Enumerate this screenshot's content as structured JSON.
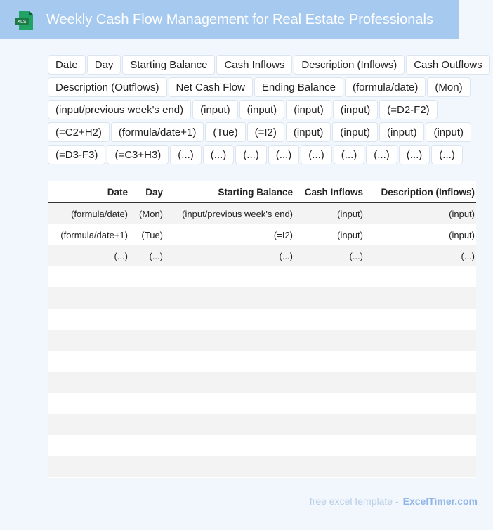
{
  "header": {
    "title": "Weekly Cash Flow Management for Real Estate Professionals",
    "icon_label": "XLS",
    "icon_color": "#1d7a45",
    "background": "#a6c9f0"
  },
  "chips": [
    "Date",
    "Day",
    "Starting Balance",
    "Cash Inflows",
    "Description (Inflows)",
    "Cash Outflows",
    "Description (Outflows)",
    "Net Cash Flow",
    "Ending Balance",
    "(formula/date)",
    "(Mon)",
    "(input/previous week's end)",
    "(input)",
    "(input)",
    "(input)",
    "(input)",
    "(=D2-F2)",
    "(=C2+H2)",
    "(formula/date+1)",
    "(Tue)",
    "(=I2)",
    "(input)",
    "(input)",
    "(input)",
    "(input)",
    "(=D3-F3)",
    "(=C3+H3)",
    "(...)",
    "(...)",
    "(...)",
    "(...)",
    "(...)",
    "(...)",
    "(...)",
    "(...)",
    "(...)"
  ],
  "table": {
    "columns": [
      "Date",
      "Day",
      "Starting Balance",
      "Cash Inflows",
      "Description (Inflows)"
    ],
    "rows": [
      {
        "num": "0",
        "cells": [
          "(formula/date)",
          "(Mon)",
          "(input/previous week's end)",
          "(input)",
          "(input)"
        ]
      },
      {
        "num": "1",
        "cells": [
          "(formula/date+1)",
          "(Tue)",
          "(=I2)",
          "(input)",
          "(input)"
        ]
      },
      {
        "num": "2",
        "cells": [
          "(...)",
          "(...)",
          "(...)",
          "(...)",
          "(...)"
        ]
      },
      {
        "num": "3",
        "cells": [
          "",
          "",
          "",
          "",
          ""
        ]
      },
      {
        "num": "4",
        "cells": [
          "",
          "",
          "",
          "",
          ""
        ]
      },
      {
        "num": "5",
        "cells": [
          "",
          "",
          "",
          "",
          ""
        ]
      },
      {
        "num": "6",
        "cells": [
          "",
          "",
          "",
          "",
          ""
        ]
      },
      {
        "num": "7",
        "cells": [
          "",
          "",
          "",
          "",
          ""
        ]
      },
      {
        "num": "8",
        "cells": [
          "",
          "",
          "",
          "",
          ""
        ]
      },
      {
        "num": "9",
        "cells": [
          "",
          "",
          "",
          "",
          ""
        ]
      },
      {
        "num": "0",
        "cells": [
          "",
          "",
          "",
          "",
          ""
        ]
      },
      {
        "num": "1",
        "cells": [
          "",
          "",
          "",
          "",
          ""
        ]
      },
      {
        "num": "2",
        "cells": [
          "",
          "",
          "",
          "",
          ""
        ]
      }
    ]
  },
  "footer": {
    "prefix": "free excel template -",
    "brand": "ExcelTimer.com"
  }
}
